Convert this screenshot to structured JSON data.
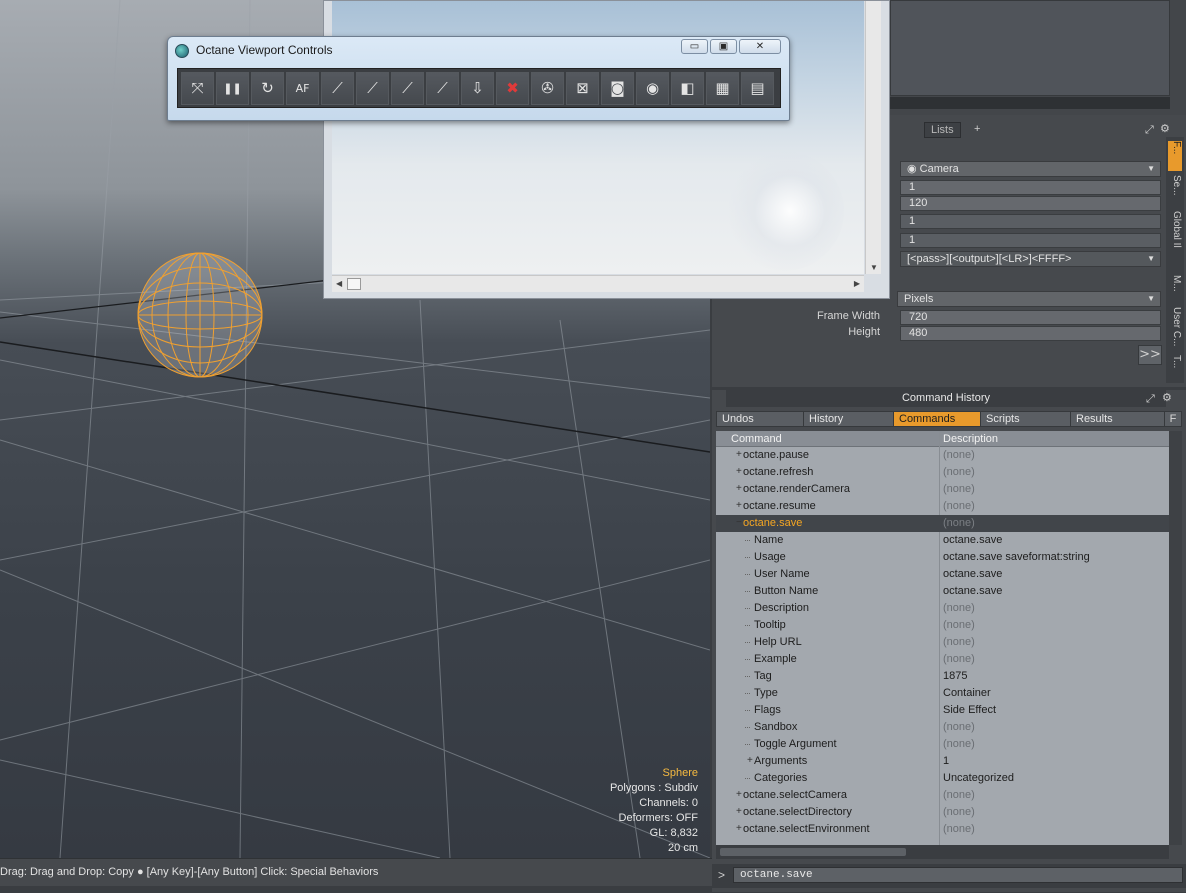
{
  "octane_window": {
    "title": "Octane Viewport Controls",
    "minimize": "▭",
    "maximize": "▣",
    "close": "✕",
    "tools": [
      {
        "name": "fit-view-icon",
        "glyph": "⤧"
      },
      {
        "name": "pause-icon",
        "glyph": "❚❚"
      },
      {
        "name": "restart-icon",
        "glyph": "↻"
      },
      {
        "name": "autofocus-picker-icon",
        "glyph": "AF"
      },
      {
        "name": "focus-picker-icon",
        "glyph": "⟋"
      },
      {
        "name": "white-balance-picker-icon",
        "glyph": "⟋"
      },
      {
        "name": "material-picker-icon",
        "glyph": "⟋"
      },
      {
        "name": "object-picker-icon",
        "glyph": "⟋"
      },
      {
        "name": "camera-target-picker-icon",
        "glyph": "⇩"
      },
      {
        "name": "stop-render-icon",
        "glyph": "✖"
      },
      {
        "name": "render-settings-icon",
        "glyph": "✇"
      },
      {
        "name": "region-render-icon",
        "glyph": "⊠"
      },
      {
        "name": "camera-icon",
        "glyph": "◙"
      },
      {
        "name": "save-render-icon",
        "glyph": "◉"
      },
      {
        "name": "cube-icon",
        "glyph": "◧"
      },
      {
        "name": "color-palette-icon",
        "glyph": "▦"
      },
      {
        "name": "settings-panel-icon",
        "glyph": "▤"
      }
    ]
  },
  "properties": {
    "tab_lists": "Lists",
    "tab_add": "+",
    "camera_dropdown": "Camera",
    "fields": [
      "1",
      "120",
      "1",
      "1"
    ],
    "output_pattern": "[<pass>][<output>][<LR>]<FFFF>",
    "units_dropdown": "Pixels",
    "frame_width_label": "Frame Width",
    "frame_width_value": "720",
    "height_label": "Height",
    "height_value": "480",
    "more_button": ">>",
    "side_tabs": [
      "F...",
      "Se...",
      "Global Il",
      "M...",
      "User C...",
      "T..."
    ]
  },
  "command_history": {
    "title": "Command History",
    "tabs": [
      "Undos",
      "History",
      "Commands",
      "Scripts",
      "Results"
    ],
    "active_tab": "Commands",
    "filter_tab": "F",
    "columns": {
      "command": "Command",
      "description": "Description"
    },
    "rows": [
      {
        "level": 0,
        "expander": "+",
        "command": "octane.pause",
        "description": "(none)",
        "none": true
      },
      {
        "level": 0,
        "expander": "+",
        "command": "octane.refresh",
        "description": "(none)",
        "none": true
      },
      {
        "level": 0,
        "expander": "+",
        "command": "octane.renderCamera",
        "description": "(none)",
        "none": true
      },
      {
        "level": 0,
        "expander": "+",
        "command": "octane.resume",
        "description": "(none)",
        "none": true
      },
      {
        "level": 0,
        "expander": "−",
        "command": "octane.save",
        "description": "(none)",
        "none": true,
        "selected": true
      },
      {
        "level": 1,
        "expander": "",
        "command": "Name",
        "description": "octane.save",
        "none": false
      },
      {
        "level": 1,
        "expander": "",
        "command": "Usage",
        "description": "octane.save saveformat:string",
        "none": false
      },
      {
        "level": 1,
        "expander": "",
        "command": "User Name",
        "description": "octane.save",
        "none": false
      },
      {
        "level": 1,
        "expander": "",
        "command": "Button Name",
        "description": "octane.save",
        "none": false
      },
      {
        "level": 1,
        "expander": "",
        "command": "Description",
        "description": "(none)",
        "none": true
      },
      {
        "level": 1,
        "expander": "",
        "command": "Tooltip",
        "description": "(none)",
        "none": true
      },
      {
        "level": 1,
        "expander": "",
        "command": "Help URL",
        "description": "(none)",
        "none": true
      },
      {
        "level": 1,
        "expander": "",
        "command": "Example",
        "description": "(none)",
        "none": true
      },
      {
        "level": 1,
        "expander": "",
        "command": "Tag",
        "description": "1875",
        "none": false
      },
      {
        "level": 1,
        "expander": "",
        "command": "Type",
        "description": "Container",
        "none": false
      },
      {
        "level": 1,
        "expander": "",
        "command": "Flags",
        "description": "Side Effect",
        "none": false
      },
      {
        "level": 1,
        "expander": "",
        "command": "Sandbox",
        "description": "(none)",
        "none": true
      },
      {
        "level": 1,
        "expander": "",
        "command": "Toggle Argument",
        "description": "(none)",
        "none": true
      },
      {
        "level": 1,
        "expander": "+",
        "command": "Arguments",
        "description": "1",
        "none": false
      },
      {
        "level": 1,
        "expander": "",
        "command": "Categories",
        "description": "Uncategorized",
        "none": false
      },
      {
        "level": 0,
        "expander": "+",
        "command": "octane.selectCamera",
        "description": "(none)",
        "none": true
      },
      {
        "level": 0,
        "expander": "+",
        "command": "octane.selectDirectory",
        "description": "(none)",
        "none": true
      },
      {
        "level": 0,
        "expander": "+",
        "command": "octane.selectEnvironment",
        "description": "(none)",
        "none": true
      }
    ],
    "prompt": ">",
    "command_input": "octane.save"
  },
  "viewport_info": {
    "selection": "Sphere",
    "polygons": "Polygons : Subdiv",
    "channels": "Channels: 0",
    "deformers": "Deformers: OFF",
    "gl": "GL: 8,832",
    "scale": "20 cm"
  },
  "status_bar": {
    "text": "Drag: Drag and Drop: Copy ● [Any Key]-[Any Button] Click: Special Behaviors"
  },
  "colors": {
    "accent": "#e89a2c",
    "selection_orange": "#f5a623",
    "wireframe": "#f0a030"
  }
}
